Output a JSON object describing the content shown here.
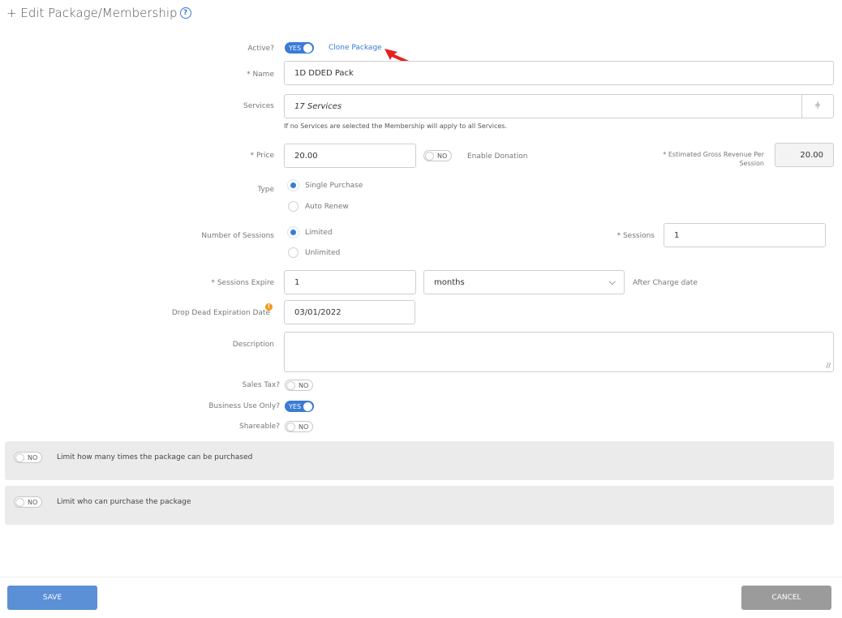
{
  "header": {
    "title": "+ Edit Package/Membership",
    "help_icon": "help-circle-icon"
  },
  "active": {
    "label": "Active?",
    "toggle": "YES",
    "clone_link": "Clone Package"
  },
  "name": {
    "label": "* Name",
    "value": "1D DDED Pack"
  },
  "services": {
    "label": "Services",
    "value": "17 Services",
    "hint": "If no Services are selected the Membership will apply to all Services.",
    "expand_icon": "double-chevron-down-icon"
  },
  "price": {
    "label": "* Price",
    "value": "20.00",
    "donation_toggle": "NO",
    "donation_label": "Enable Donation",
    "egr_label_1": "* Estimated Gross Revenue Per",
    "egr_label_2": "Session",
    "egr_value": "20.00"
  },
  "type": {
    "label": "Type",
    "options": [
      "Single Purchase",
      "Auto Renew"
    ]
  },
  "sessions_count": {
    "label": "Number of Sessions",
    "options": [
      "Limited",
      "Unlimited"
    ],
    "sessions_label": "* Sessions",
    "sessions_value": "1"
  },
  "expire": {
    "label": "* Sessions Expire",
    "value": "1",
    "unit": "months",
    "after_label": "After Charge date"
  },
  "drop_dead": {
    "label": "Drop Dead Expiration Date",
    "value": "03/01/2022",
    "info_badge": "!"
  },
  "description": {
    "label": "Description",
    "value": ""
  },
  "sales_tax": {
    "label": "Sales Tax?",
    "toggle": "NO"
  },
  "business_use": {
    "label": "Business Use Only?",
    "toggle": "YES"
  },
  "shareable": {
    "label": "Shareable?",
    "toggle": "NO"
  },
  "limit_purchases": {
    "toggle": "NO",
    "text": "Limit how many times the package can be purchased"
  },
  "limit_who": {
    "toggle": "NO",
    "text": "Limit who can purchase the package"
  },
  "footer": {
    "save": "SAVE",
    "cancel": "CANCEL"
  },
  "colors": {
    "accent": "#3a7bd5",
    "save_button": "#5b8fd6",
    "cancel_button": "#9b9b9b",
    "panel_bg": "#ebebeb",
    "annotation_arrow": "#e8201e"
  }
}
